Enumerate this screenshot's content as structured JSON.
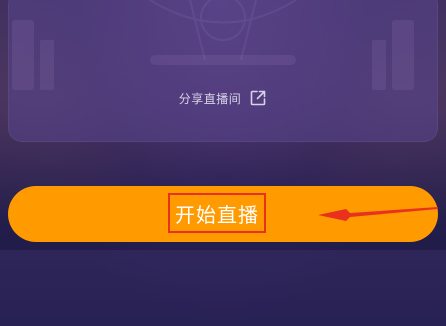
{
  "share": {
    "label": "分享直播间",
    "icon": "external-link-icon"
  },
  "start_button": {
    "label": "开始直播",
    "color": "#ff9a00"
  },
  "annotation": {
    "highlight_color": "#e8321e",
    "arrow_color": "#e8321e"
  }
}
